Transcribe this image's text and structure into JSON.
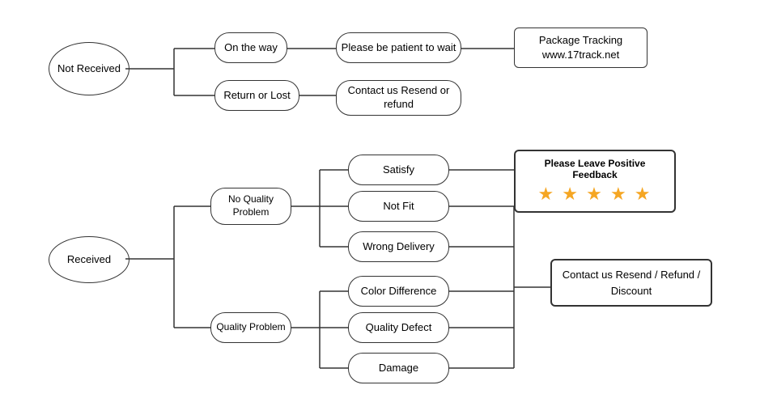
{
  "nodes": {
    "not_received": {
      "label": "Not\nReceived"
    },
    "received": {
      "label": "Received"
    },
    "on_the_way": {
      "label": "On the way"
    },
    "return_or_lost": {
      "label": "Return or Lost"
    },
    "patient_wait": {
      "label": "Please be patient to wait"
    },
    "contact_resend_refund": {
      "label": "Contact us\nResend or refund"
    },
    "package_tracking": {
      "label": "Package Tracking\nwww.17track.net"
    },
    "no_quality_problem": {
      "label": "No\nQuality Problem"
    },
    "quality_problem": {
      "label": "Quality Problem"
    },
    "satisfy": {
      "label": "Satisfy"
    },
    "not_fit": {
      "label": "Not Fit"
    },
    "wrong_delivery": {
      "label": "Wrong Delivery"
    },
    "color_difference": {
      "label": "Color Difference"
    },
    "quality_defect": {
      "label": "Quality Defect"
    },
    "damage": {
      "label": "Damage"
    },
    "positive_feedback": {
      "label": "Please Leave Positive Feedback"
    },
    "contact_resend_refund2": {
      "label": "Contact us\nResend / Refund / Discount"
    }
  },
  "stars": "★ ★ ★ ★ ★"
}
